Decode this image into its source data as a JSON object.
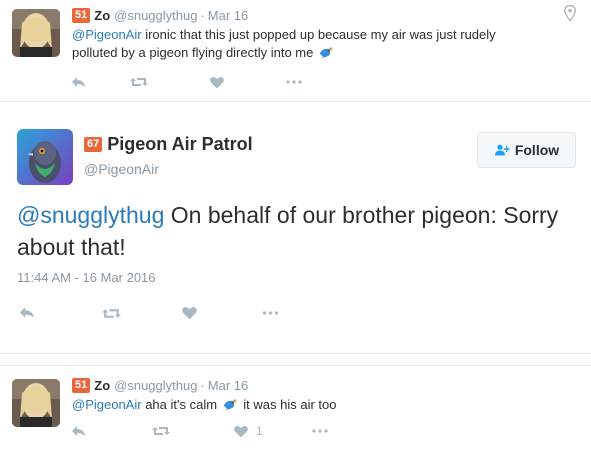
{
  "tweet1": {
    "badge": "51",
    "name": "Zo",
    "handle": "@snugglythug",
    "separator": "·",
    "time": "Mar 16",
    "mention": "@PigeonAir",
    "text": " ironic that this just popped up because my air was just rudely polluted by a pigeon flying directly into me",
    "icons": [
      "reply-icon",
      "retweet-icon",
      "like-icon",
      "more-icon",
      "location-icon",
      "bird-emoji-icon"
    ]
  },
  "tweet2": {
    "badge": "67",
    "name": "Pigeon Air Patrol",
    "handle": "@PigeonAir",
    "follow_label": "Follow",
    "mention": "@snugglythug",
    "text": " On behalf of our brother pigeon: Sorry about that!",
    "timestamp": "11:44 AM - 16 Mar 2016",
    "icons": [
      "follow-person-icon",
      "reply-icon",
      "retweet-icon",
      "like-icon",
      "more-icon"
    ]
  },
  "tweet3": {
    "badge": "51",
    "name": "Zo",
    "handle": "@snugglythug",
    "separator": "·",
    "time": "Mar 16",
    "mention": "@PigeonAir",
    "text_before": " aha it's calm",
    "text_after": " it was his air too",
    "like_count": "1",
    "icons": [
      "reply-icon",
      "retweet-icon",
      "like-icon",
      "more-icon",
      "bird-emoji-icon"
    ]
  },
  "colors": {
    "link": "#2b7bb9",
    "badge": "#e8673b",
    "muted": "#8899a6",
    "action": "#aab8c2",
    "border": "#e1e8ed",
    "text": "#292f33"
  }
}
